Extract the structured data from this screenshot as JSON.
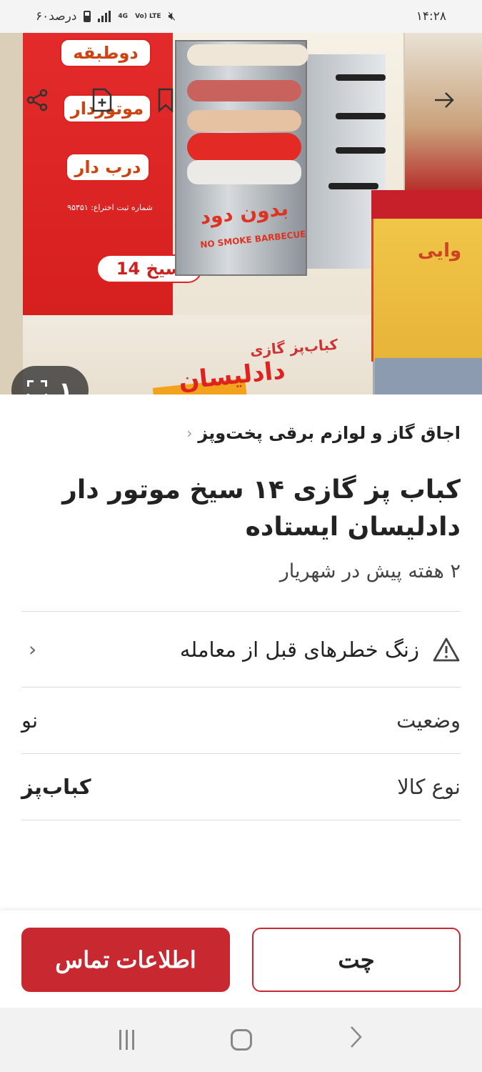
{
  "status_bar": {
    "time": "۱۴:۲۸",
    "battery": "۶۰درصد",
    "network_top": "4G",
    "network_label": "Vo) LTE"
  },
  "hero": {
    "counter": "۱",
    "box_texts": {
      "top_label": "دوطبقه",
      "pill_motor": "موتوردار",
      "pill_door": "درب دار",
      "patent": "شماره ثبت اختراع: ۹۵۳۵۱",
      "skewers": "14 سیخ",
      "no_smoke_fa": "بدون دود",
      "no_smoke_en": "NO SMOKE BARBECUE",
      "bottom_label": "کباب‌پز گازی",
      "brand": "دادلیسان",
      "side_brand": "وایی"
    },
    "icons": [
      "share-icon",
      "add-note-icon",
      "bookmark-icon",
      "forward-arrow-icon"
    ]
  },
  "breadcrumb": {
    "label": "اجاق گاز و لوازم برقی پخت‌وپز",
    "chevron": "‹"
  },
  "listing": {
    "title": "کباب پز گازی ۱۴ سیخ موتور دار دادلیسان ایستاده",
    "subtitle": "۲ هفته پیش در شهریار"
  },
  "risk_notice": {
    "label": "زنگ خطرهای قبل از معامله",
    "chevron": "‹"
  },
  "details": [
    {
      "key": "وضعیت",
      "value": "نو",
      "bold": false
    },
    {
      "key": "نوع کالا",
      "value": "کباب‌پز",
      "bold": true
    }
  ],
  "actions": {
    "contact_label": "اطلاعات تماس",
    "chat_label": "چت"
  },
  "nav": {
    "back_glyph": "‹"
  },
  "colors": {
    "brand_red": "#c8282f"
  }
}
